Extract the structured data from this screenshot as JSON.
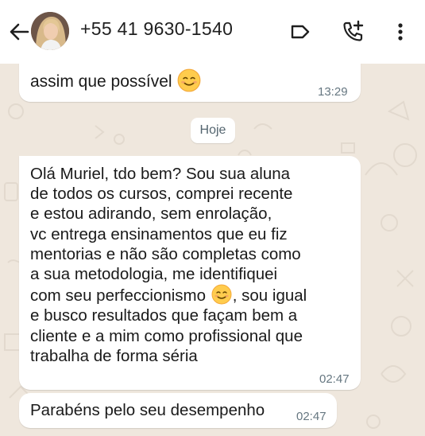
{
  "header": {
    "contact_name": "+55 41 9630-1540",
    "icons": [
      "back-arrow-icon",
      "avatar",
      "label-icon",
      "add-call-icon",
      "more-vert-icon"
    ]
  },
  "chat": {
    "date_separator": "Hoje",
    "messages": [
      {
        "lines": [
          "assim que possível"
        ],
        "emoji_after": "smiling-face-emoji",
        "time": "13:29"
      },
      {
        "lines": [
          "Olá Muriel, tdo bem? Sou sua aluna",
          "de todos os cursos, comprei recente",
          "e estou adirando, sem enrolação,",
          "vc entrega ensinamentos que eu fiz",
          "mentorias e não são completas como",
          "a sua metodologia, me identifiquei",
          "com seu perfeccionismo",
          ", sou igual",
          "e busco resultados que façam bem a",
          "cliente e a mim como profissional que",
          "trabalha de forma séria"
        ],
        "time": "02:47"
      },
      {
        "lines": [
          "Parabéns pelo seu desempenho"
        ],
        "time": "02:47"
      }
    ]
  },
  "colors": {
    "chat_background": "#efe7dd",
    "bubble": "#ffffff",
    "timestamp": "#667781"
  }
}
